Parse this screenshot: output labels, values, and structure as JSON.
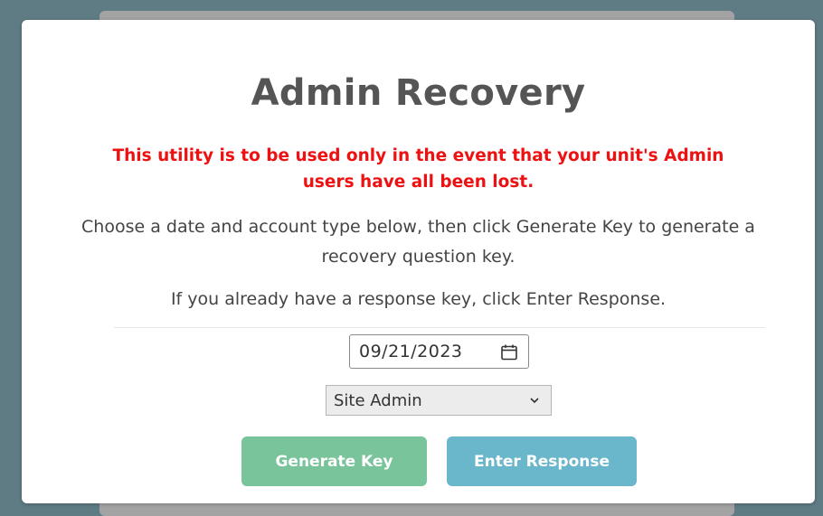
{
  "modal": {
    "title": "Admin Recovery",
    "warning": "This utility is to be used only in the event that your unit's Admin users have all been lost.",
    "instructions": "Choose a date and account type below, then click Generate Key to generate a recovery question key.",
    "hint": "If you already have a response key, click Enter Response."
  },
  "form": {
    "date_value": "09/21/2023",
    "account_type": "Site Admin"
  },
  "buttons": {
    "generate_label": "Generate Key",
    "enter_label": "Enter Response"
  },
  "colors": {
    "warning": "#ee1111",
    "generate_button": "#79c49a",
    "enter_button": "#6ab6cb"
  },
  "icons": {
    "date": "calendar-icon",
    "select": "chevron-down-icon"
  }
}
